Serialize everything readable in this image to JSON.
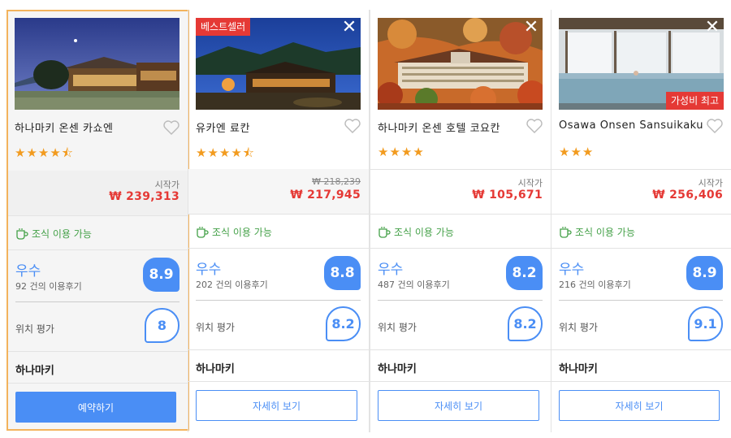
{
  "colors": {
    "accent": "#4a8ef5",
    "price": "#e53935",
    "breakfast": "#43a047",
    "star": "#f29b1f",
    "selected_border": "#f3b35c"
  },
  "hotels": [
    {
      "name": "하나마키 온센 카쇼엔",
      "stars": "★★★★⯪",
      "price_label": "시작가",
      "old_price": "",
      "price": "₩ 239,313",
      "breakfast": "조식 이용 가능",
      "rating_label": "우수",
      "reviews": "92 건의 이용후기",
      "score": "8.9",
      "location_label": "위치 평가",
      "location_score": "8",
      "area": "하나마키",
      "button": "예약하기",
      "badge_top": "",
      "badge_bottom": ""
    },
    {
      "name": "유카엔 료칸",
      "stars": "★★★★⯪",
      "price_label": "",
      "old_price": "₩ 218,239",
      "price": "₩ 217,945",
      "breakfast": "조식 이용 가능",
      "rating_label": "우수",
      "reviews": "202 건의 이용후기",
      "score": "8.8",
      "location_label": "위치 평가",
      "location_score": "8.2",
      "area": "하나마키",
      "button": "자세히 보기",
      "badge_top": "베스트셀러",
      "badge_bottom": ""
    },
    {
      "name": "하나마키 온센 호텔 코요칸",
      "stars": "★★★★",
      "price_label": "시작가",
      "old_price": "",
      "price": "₩ 105,671",
      "breakfast": "조식 이용 가능",
      "rating_label": "우수",
      "reviews": "487 건의 이용후기",
      "score": "8.2",
      "location_label": "위치 평가",
      "location_score": "8.2",
      "area": "하나마키",
      "button": "자세히 보기",
      "badge_top": "",
      "badge_bottom": ""
    },
    {
      "name": "Osawa Onsen Sansuikaku",
      "stars": "★★★",
      "price_label": "시작가",
      "old_price": "",
      "price": "₩ 256,406",
      "breakfast": "조식 이용 가능",
      "rating_label": "우수",
      "reviews": "216 건의 이용후기",
      "score": "8.9",
      "location_label": "위치 평가",
      "location_score": "9.1",
      "area": "하나마키",
      "button": "자세히 보기",
      "badge_top": "",
      "badge_bottom": "가성비 최고"
    }
  ]
}
